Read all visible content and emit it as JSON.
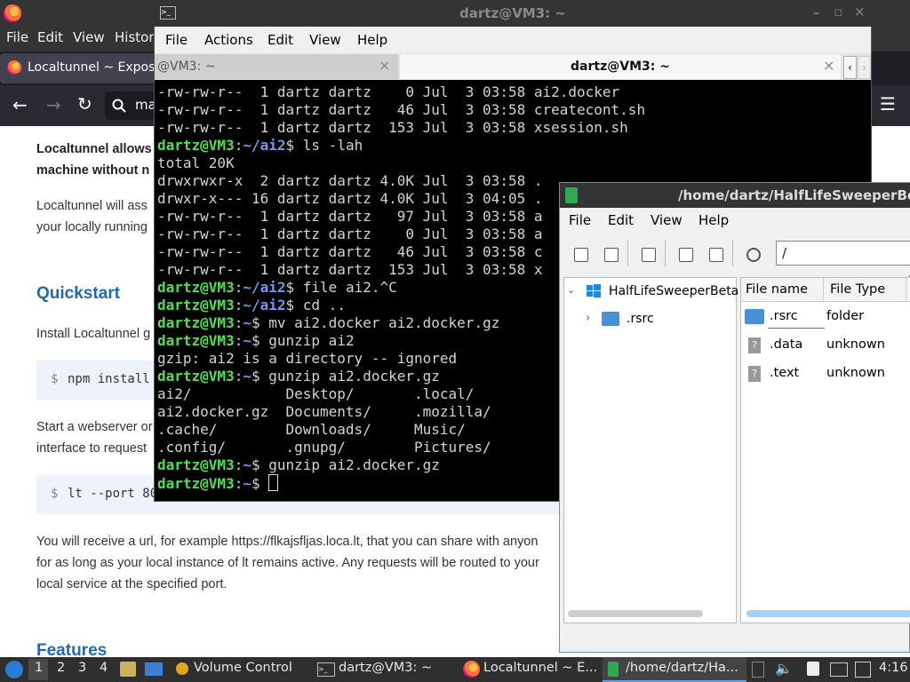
{
  "firefox": {
    "menubar": [
      "File",
      "Edit",
      "View",
      "History"
    ],
    "tab_title": "Localtunnel ~ Expose",
    "url_text": "ma",
    "content": {
      "intro_line1": "Localtunnel allows",
      "intro_line2": "machine without n",
      "para1_line1": "Localtunnel will ass",
      "para1_line2": "your locally running",
      "quickstart_heading": "Quickstart",
      "install_text": "Install Localtunnel g",
      "code1_prompt": "$",
      "code1_cmd": "npm install",
      "start_line1": "Start a webserver or",
      "start_line2": "interface to request",
      "code2_prompt": "$",
      "code2_cmd": "lt --port 80",
      "receive_line1": "You will receive a url, for example https://flkajsfljas.loca.lt, that you can share with anyon",
      "receive_line2": "for as long as your local instance of lt remains active. Any requests will be routed to your",
      "receive_line3": "local service at the specified port.",
      "features_heading": "Features"
    }
  },
  "terminal": {
    "title": "dartz@VM3: ~",
    "menubar": [
      "File",
      "Actions",
      "Edit",
      "View",
      "Help"
    ],
    "tab1_label": "@VM3: ~",
    "tab2_label": "dartz@VM3: ~",
    "prompt_user": "dartz@VM3",
    "lines": {
      "l0": "-rw-rw-r--  1 dartz dartz    0 Jul  3 03:58 ai2.docker",
      "l1": "-rw-rw-r--  1 dartz dartz   46 Jul  3 03:58 createcont.sh",
      "l2": "-rw-rw-r--  1 dartz dartz  153 Jul  3 03:58 xsession.sh",
      "l3_path": "~/ai2",
      "l3_cmd": "$ ls -lah",
      "l4": "total 20K",
      "l5": "drwxrwxr-x  2 dartz dartz 4.0K Jul  3 03:58 .",
      "l6": "drwxr-x--- 16 dartz dartz 4.0K Jul  3 04:05 .",
      "l7": "-rw-rw-r--  1 dartz dartz   97 Jul  3 03:58 a",
      "l8": "-rw-rw-r--  1 dartz dartz    0 Jul  3 03:58 a",
      "l9": "-rw-rw-r--  1 dartz dartz   46 Jul  3 03:58 c",
      "l10": "-rw-rw-r--  1 dartz dartz  153 Jul  3 03:58 x",
      "l11_path": "~/ai2",
      "l11_cmd": "$ file ai2.^C",
      "l12_path": "~/ai2",
      "l12_cmd": "$ cd ..",
      "l13_path": "~",
      "l13_cmd": "$ mv ai2.docker ai2.docker.gz",
      "l14_path": "~",
      "l14_cmd": "$ gunzip ai2",
      "l15": "gzip: ai2 is a directory -- ignored",
      "l16_path": "~",
      "l16_cmd": "$ gunzip ai2.docker.gz",
      "l17": "ai2/           Desktop/       .local/",
      "l18": "ai2.docker.gz  Documents/     .mozilla/",
      "l19": ".cache/        Downloads/     Music/",
      "l20": ".config/       .gnupg/        Pictures/",
      "l21_path": "~",
      "l21_cmd": "$ gunzip ai2.docker.gz",
      "l22_path": "~",
      "l22_cmd": "$ "
    }
  },
  "filemanager": {
    "title": "/home/dartz/HalfLifeSweeperBeta",
    "menubar": [
      "File",
      "Edit",
      "View",
      "Help"
    ],
    "path_value": "/",
    "tree_root": "HalfLifeSweeperBeta",
    "tree_child": ".rsrc",
    "col_name": "File name",
    "col_type": "File Type",
    "files": [
      {
        "name": ".rsrc",
        "type": "folder"
      },
      {
        "name": ".data",
        "type": "unknown"
      },
      {
        "name": ".text",
        "type": "unknown"
      }
    ]
  },
  "taskbar": {
    "workspaces": [
      "1",
      "2",
      "3",
      "4"
    ],
    "items": [
      "Volume Control",
      "dartz@VM3: ~",
      "Localtunnel ~ E...",
      "/home/dartz/Ha..."
    ],
    "clock": "4:16"
  }
}
